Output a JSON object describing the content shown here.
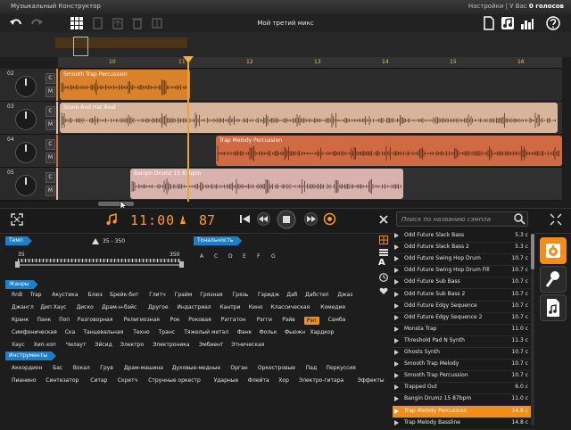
{
  "titlebar": {
    "title": "Музыкальный Конструктор",
    "settings": "Настройки",
    "votes_prefix": "У Вас",
    "votes_value": "0 голосов",
    "separator": "|"
  },
  "mix_name": "Мой третий микс",
  "ruler": [
    "10",
    "11",
    "12",
    "13",
    "14",
    "15",
    "16"
  ],
  "tracks": [
    {
      "num": "02",
      "clip": "Smooth Trap Percussion"
    },
    {
      "num": "03",
      "clip": "Snare And Hat Beat"
    },
    {
      "num": "04",
      "clip": "Trap Melody Percussion"
    },
    {
      "num": "05",
      "clip": "Bangin Drumz 15 87bpm"
    }
  ],
  "track_buttons": {
    "c": "C",
    "m": "M"
  },
  "transport": {
    "time": "11:00",
    "bpm": "87",
    "search_placeholder": "Поиск по названию сэмпла"
  },
  "filters": {
    "tempo_label": "Темп",
    "tempo_range": "35 - 350",
    "tempo_min": "35",
    "tempo_max": "350",
    "key_label": "Тональность",
    "keys": [
      "A",
      "C",
      "D",
      "E",
      "F",
      "G"
    ],
    "genres_label": "Жанры",
    "genres": [
      [
        "RnB",
        "Trap",
        "Акустика",
        "Блюз",
        "Брейк-бит",
        "Глитч",
        "Грайм",
        "Грязная",
        "Грязь",
        "Гэридж",
        "Даб",
        "Дабстеп",
        "Джаз"
      ],
      [
        "Джангл",
        "Дип Хаус",
        "Диско",
        "Драм-н-бэйс",
        "Другое",
        "Индастриал",
        "Кантри",
        "Кино",
        "Классическая",
        "Комедия"
      ],
      [
        "Кранк",
        "Панк",
        "Поп",
        "Разговорная",
        "Религиозная",
        "Рок",
        "Роковая",
        "Рэггатон",
        "Рэгги",
        "Рэйв",
        "Рэп",
        "Самба"
      ],
      [
        "Симфоническая",
        "Ска",
        "Танцевальная",
        "Техно",
        "Транс",
        "Тяжелый метал",
        "Фанк",
        "Фольк",
        "Фьюжн",
        "Хардкор"
      ],
      [
        "Хаус",
        "Хип-хоп",
        "Чилаут",
        "Эйсид",
        "Электро",
        "Электроника",
        "Эмбиент",
        "Этническая"
      ]
    ],
    "selected_genre": "Рэп",
    "instruments_label": "Инструменты",
    "instruments": [
      [
        "Аккордион",
        "Бас",
        "Вокал",
        "Грув",
        "Драм-машина",
        "Духовые-медные",
        "Орган",
        "Оркестровые",
        "Пад",
        "Перкуссия"
      ],
      [
        "Пианино",
        "Синтезатор",
        "Ситар",
        "Скретч",
        "Струнные оркестр",
        "Ударные",
        "Флейта",
        "Хор",
        "Электро-гитара",
        "Эффекты"
      ]
    ]
  },
  "samples": [
    {
      "name": "Odd Future Slack Bass",
      "dur": "5.3 с"
    },
    {
      "name": "Odd Future Slack Bass 2",
      "dur": "5.3 с"
    },
    {
      "name": "Odd Future Swing Hop Drum",
      "dur": "10.7 с"
    },
    {
      "name": "Odd Future Swing Hop Drum Fill",
      "dur": "10.7 с"
    },
    {
      "name": "Odd Future Sub Bass",
      "dur": "10.7 с"
    },
    {
      "name": "Odd Future Sub Bass 2",
      "dur": "10.7 с"
    },
    {
      "name": "Odd Future Edgy Sequence",
      "dur": "10.7 с"
    },
    {
      "name": "Odd Future Edgy Sequence 2",
      "dur": "10.7 с"
    },
    {
      "name": "Monsta Trap",
      "dur": "11.0 с"
    },
    {
      "name": "Threshold Pad N Synth",
      "dur": "11.3 с"
    },
    {
      "name": "Ghosts Synth",
      "dur": "10.7 с"
    },
    {
      "name": "Smooth Trap Melody",
      "dur": "10.7 с"
    },
    {
      "name": "Smooth Trap Percussion",
      "dur": "10.7 с"
    },
    {
      "name": "Trapped Out",
      "dur": "6.0 с"
    },
    {
      "name": "Bangin Drumz 15 87bpm",
      "dur": "11.0 с"
    },
    {
      "name": "Trap Melody Percussion",
      "dur": "14.8 с"
    },
    {
      "name": "Trap Melody Bassline",
      "dur": "14.8 с"
    }
  ],
  "selected_sample_index": 15,
  "colors": {
    "accent": "#f08d1c",
    "header_blue": "#1e7fc9",
    "clip_orange": "#d9822b",
    "clip_beige": "#d7b49a",
    "clip_red": "#d06a42",
    "clip_pink": "#d9b2ad"
  }
}
